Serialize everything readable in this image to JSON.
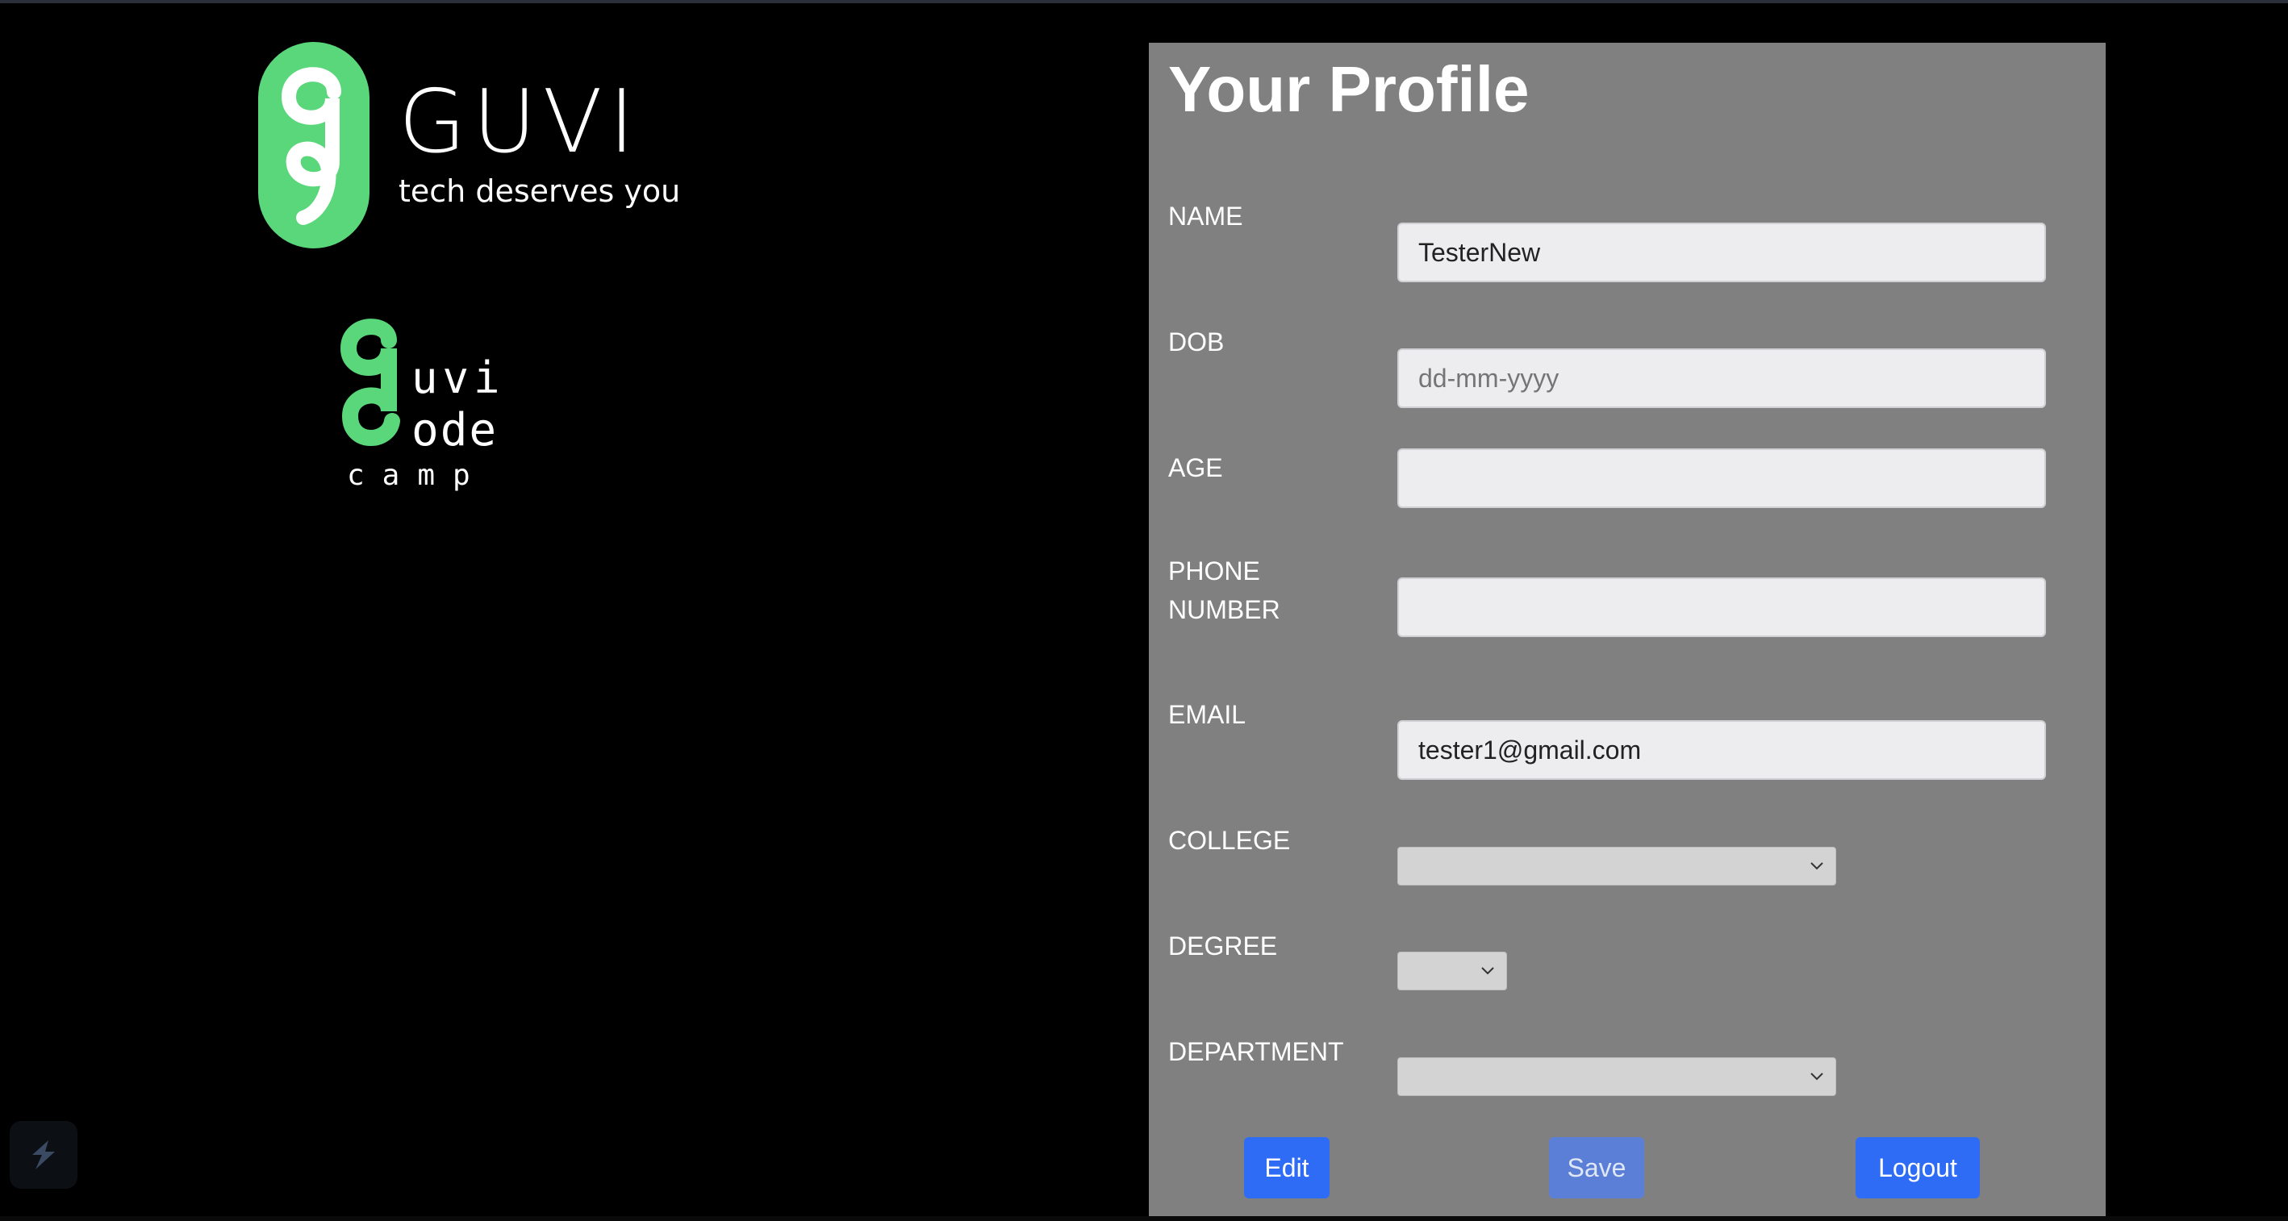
{
  "brand": {
    "logo_name": "GUVI",
    "tagline": "tech deserves you",
    "codecamp_line1": "uvi",
    "codecamp_line2": "ode",
    "codecamp_line3": "camp",
    "accent_color": "#5ad77a"
  },
  "profile": {
    "title": "Your Profile",
    "fields": {
      "name": {
        "label": "NAME",
        "value": "TesterNew"
      },
      "dob": {
        "label": "DOB",
        "placeholder": "dd-mm-yyyy"
      },
      "age": {
        "label": "AGE",
        "value": ""
      },
      "phone": {
        "label": "PHONE NUMBER",
        "value": ""
      },
      "email": {
        "label": "EMAIL",
        "value": "tester1@gmail.com"
      },
      "college": {
        "label": "COLLEGE",
        "selected": ""
      },
      "degree": {
        "label": "DEGREE",
        "selected": ""
      },
      "department": {
        "label": "DEPARTMENT",
        "selected": ""
      }
    },
    "buttons": {
      "edit": "Edit",
      "save": "Save",
      "logout": "Logout"
    }
  },
  "colors": {
    "page_background": "#000000",
    "panel_background": "#808080",
    "button_primary": "#2f6cf6",
    "button_disabled": "#5b7fd6"
  },
  "icons": {
    "corner_widget": "feedback-widget-icon",
    "select_chevron": "chevron-down-icon"
  }
}
